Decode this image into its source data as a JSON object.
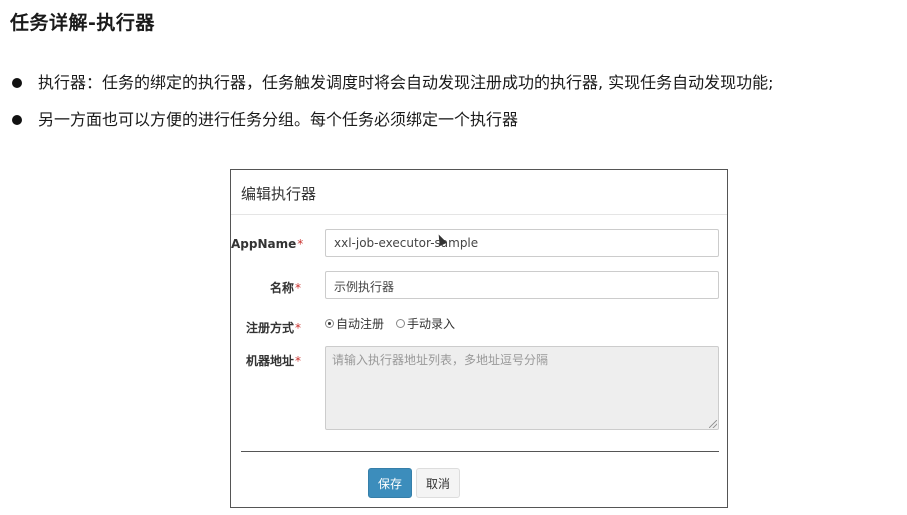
{
  "slide": {
    "title": "任务详解-执行器",
    "bullets": [
      "执行器：任务的绑定的执行器，任务触发调度时将会自动发现注册成功的执行器, 实现任务自动发现功能;",
      "另一方面也可以方便的进行任务分组。每个任务必须绑定一个执行器"
    ]
  },
  "modal": {
    "title": "编辑执行器",
    "fields": {
      "appname": {
        "label": "AppName",
        "required_mark": "*",
        "value": "xxl-job-executor-sample"
      },
      "name": {
        "label": "名称",
        "required_mark": "*",
        "value": "示例执行器"
      },
      "register_type": {
        "label": "注册方式",
        "required_mark": "*",
        "options": [
          {
            "label": "自动注册",
            "checked": true
          },
          {
            "label": "手动录入",
            "checked": false
          }
        ]
      },
      "address": {
        "label": "机器地址",
        "required_mark": "*",
        "placeholder": "请输入执行器地址列表，多地址逗号分隔"
      }
    },
    "buttons": {
      "save": "保存",
      "cancel": "取消"
    }
  },
  "colors": {
    "primary_button": "#3c8dbc",
    "required": "#c9302c",
    "disabled_bg": "#eeeeee"
  }
}
